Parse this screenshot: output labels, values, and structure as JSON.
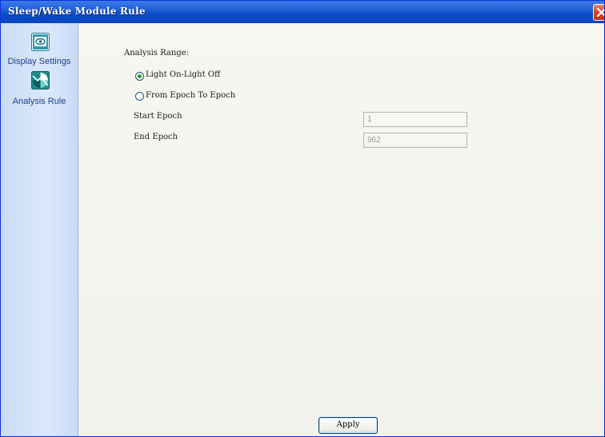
{
  "window": {
    "title": "Sleep/Wake Module Rule"
  },
  "sidebar": {
    "items": [
      {
        "label": "Display Settings",
        "icon": "eye-icon"
      },
      {
        "label": "Analysis Rule",
        "icon": "analysis-chart-icon"
      }
    ]
  },
  "main": {
    "analysis_range_label": "Analysis Range:",
    "options": [
      {
        "label": "Light On-Light Off",
        "selected": true
      },
      {
        "label": "From Epoch To Epoch",
        "selected": false
      }
    ],
    "start_epoch": {
      "label": "Start Epoch",
      "value": "1"
    },
    "end_epoch": {
      "label": "End Epoch",
      "value": "962"
    },
    "apply_label": "Apply"
  },
  "colors": {
    "titlebar": "#0a4ac8",
    "sidebar": "#d0e1f9",
    "content_bg": "#f4f3ee",
    "radio_selected": "#21a121",
    "close_button": "#d4432a"
  }
}
